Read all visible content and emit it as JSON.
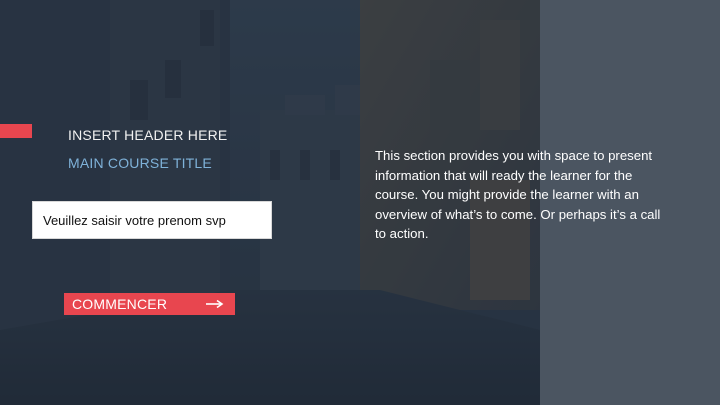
{
  "slide": {
    "header": "INSERT HEADER HERE",
    "course_title": "MAIN COURSE TITLE",
    "name_input": {
      "value": "",
      "placeholder": "Veuillez saisir votre prenom svp"
    },
    "start_button": {
      "label": "COMMENCER",
      "icon": "arrow-right-icon"
    },
    "description": "This section provides you with space to present information that will ready the learner for the course. You might provide the learner with an overview of what’s to come. Or perhaps it’s a call to action."
  },
  "colors": {
    "accent": "#e8464f",
    "title_blue": "#7fb2d9",
    "right_panel": "#4b5561",
    "overlay": "#222e3c"
  }
}
